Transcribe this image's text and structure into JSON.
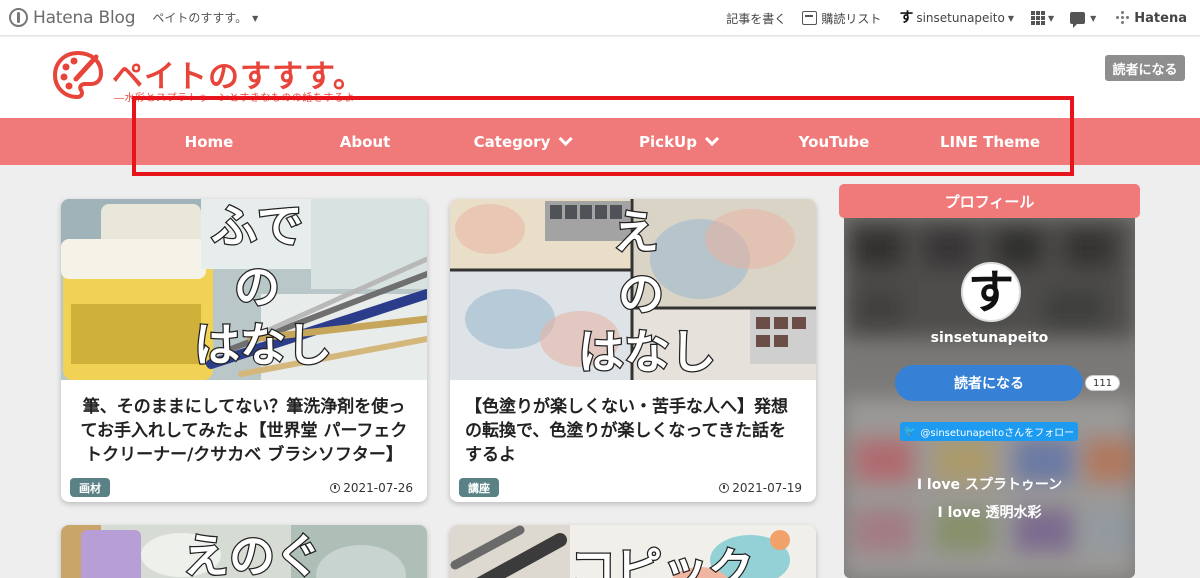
{
  "topbar": {
    "logo_text": "Hatena Blog",
    "blog_name": "ペイトのすすす。",
    "write_post": "記事を書く",
    "reader_list": "購読リスト",
    "user_mark": "す",
    "username": "sinsetunapeito",
    "hatena": "Hatena"
  },
  "header": {
    "title": "ペイトのすすす。",
    "tagline": "―水彩とスプラトゥーンとすきなものの話をするよ―",
    "subscribe_label": "読者になる"
  },
  "nav": {
    "items": [
      {
        "label": "Home"
      },
      {
        "label": "About"
      },
      {
        "label": "Category"
      },
      {
        "label": "PickUp"
      },
      {
        "label": "YouTube"
      },
      {
        "label": "LINE Theme"
      }
    ]
  },
  "articles": [
    {
      "thumb_text": [
        "ふで",
        "の",
        "はなし"
      ],
      "title": "筆、そのままにしてない？筆洗浄剤を使ってお手入れしてみたよ【世界堂 パーフェクトクリーナー/クサカベ ブラシソフター】",
      "tag": "画材",
      "date": "2021-07-26"
    },
    {
      "thumb_text": [
        "え",
        "の",
        "はなし"
      ],
      "title": "【色塗りが楽しくない・苦手な人へ】発想の転換で、色塗りが楽しくなってきた話をするよ",
      "tag": "講座",
      "date": "2021-07-19"
    },
    {
      "thumb_text": [
        "えのぐ"
      ]
    },
    {
      "thumb_text": [
        "コピック"
      ]
    }
  ],
  "profile": {
    "heading": "プロフィール",
    "avatar_char": "す",
    "name": "sinsetunapeito",
    "subscribe_label": "読者になる",
    "subscriber_count": "111",
    "twitter_label": "@sinsetunapeitoさんをフォロー",
    "lines": [
      "I love スプラトゥーン",
      "I love 透明水彩"
    ]
  },
  "colors": {
    "accent": "#f0797a",
    "title_red": "#e8453a",
    "tag_bg": "#5a8186",
    "subscribe_blue": "#3680d6",
    "highlight_red": "#e8141c"
  }
}
